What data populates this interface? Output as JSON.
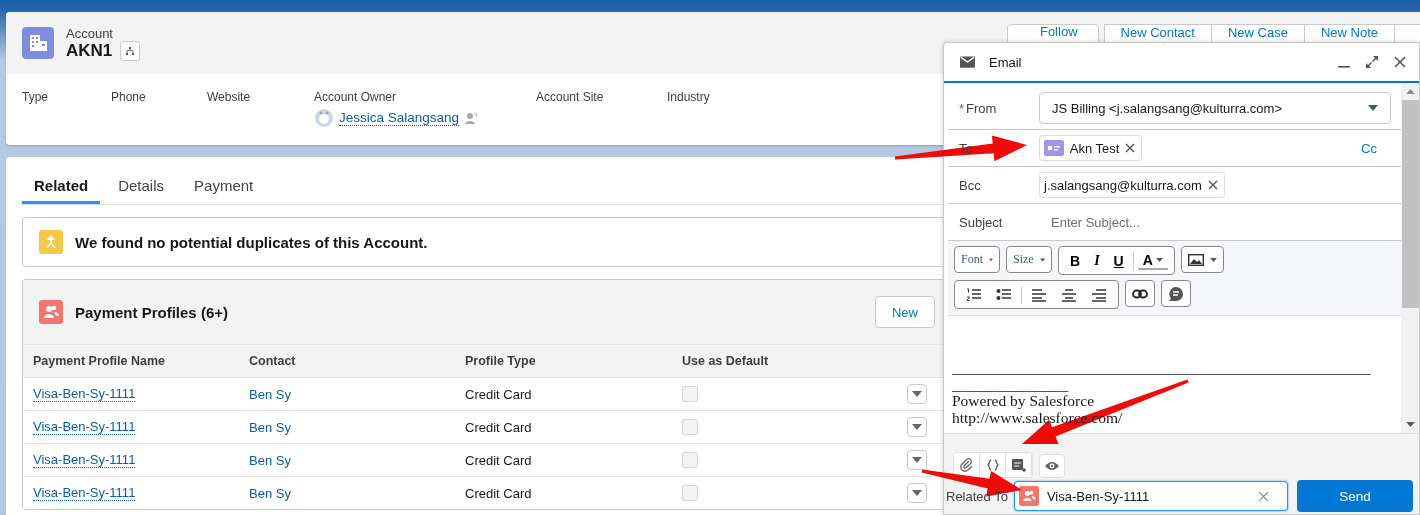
{
  "record": {
    "object_type": "Account",
    "name": "AKN1"
  },
  "actions": [
    "Follow",
    "New Contact",
    "New Case",
    "New Note"
  ],
  "highlights": [
    {
      "label": "Type"
    },
    {
      "label": "Phone"
    },
    {
      "label": "Website"
    },
    {
      "label": "Account Owner",
      "value": "Jessica Salangsang"
    },
    {
      "label": "Account Site"
    },
    {
      "label": "Industry"
    }
  ],
  "tabs": [
    {
      "label": "Related",
      "selected": true
    },
    {
      "label": "Details",
      "selected": false
    },
    {
      "label": "Payment",
      "selected": false
    }
  ],
  "duplicates_notice": "We found no potential duplicates of this Account.",
  "related_list": {
    "title": "Payment Profiles (6+)",
    "new_button": "New",
    "columns": [
      "Payment Profile Name",
      "Contact",
      "Profile Type",
      "Use as Default"
    ],
    "rows": [
      {
        "name": "Visa-Ben-Sy-1111",
        "contact": "Ben Sy",
        "profile_type": "Credit Card",
        "use_as_default": false
      },
      {
        "name": "Visa-Ben-Sy-1111",
        "contact": "Ben Sy",
        "profile_type": "Credit Card",
        "use_as_default": false
      },
      {
        "name": "Visa-Ben-Sy-1111",
        "contact": "Ben Sy",
        "profile_type": "Credit Card",
        "use_as_default": false
      },
      {
        "name": "Visa-Ben-Sy-1111",
        "contact": "Ben Sy",
        "profile_type": "Credit Card",
        "use_as_default": false
      }
    ]
  },
  "email": {
    "title": "Email",
    "from_label": "From",
    "from_required": true,
    "required_mark": "*",
    "from_value": "JS Billing <j.salangsang@kulturra.com>",
    "to_label": "To",
    "to": [
      {
        "name": "Akn Test"
      }
    ],
    "cc_link": "Cc",
    "bcc_label": "Bcc",
    "bcc": [
      {
        "name": "j.salangsang@kulturra.com"
      }
    ],
    "subject_label": "Subject",
    "subject_placeholder": "Enter Subject...",
    "toolbar": {
      "font": "Font",
      "size": "Size",
      "format_buttons": [
        "B",
        "I",
        "U"
      ],
      "text_color": "A"
    },
    "body": [
      "______________________________________________________",
      "_______________",
      "Powered by Salesforce",
      "http://www.salesforce.com/"
    ],
    "related_to_label": "Related To",
    "related_to_value": "Visa-Ben-Sy-1111",
    "send_button": "Send"
  },
  "annotations": [
    {
      "kind": "arrow"
    },
    {
      "kind": "arrow"
    },
    {
      "kind": "arrow"
    }
  ]
}
